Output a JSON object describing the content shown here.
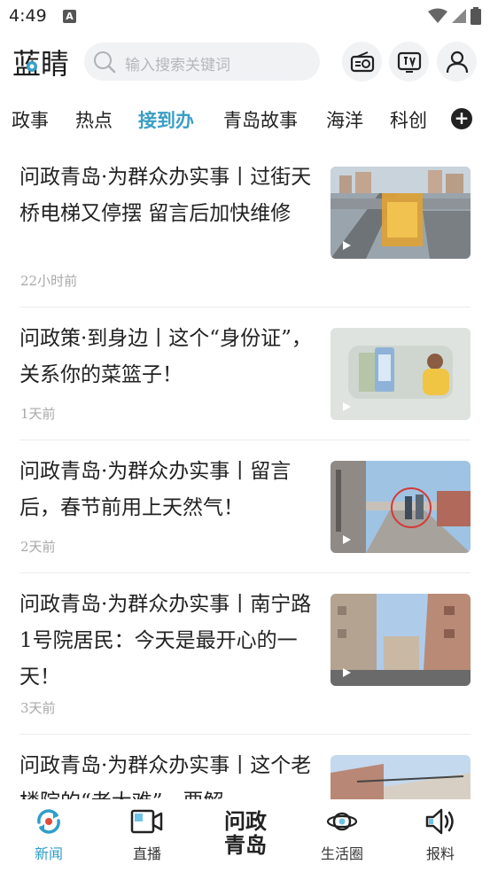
{
  "status_bar": {
    "time": "4:49",
    "notification_badge": "A"
  },
  "header": {
    "logo_text": "蓝睛",
    "search_placeholder": "输入搜索关键词",
    "icons": [
      "radio-icon",
      "tv-icon",
      "user-icon"
    ]
  },
  "tabs": [
    {
      "label": "政事",
      "active": false
    },
    {
      "label": "热点",
      "active": false
    },
    {
      "label": "接到办",
      "active": true
    },
    {
      "label": "青岛故事",
      "active": false
    },
    {
      "label": "海洋",
      "active": false
    },
    {
      "label": "科创",
      "active": false
    }
  ],
  "news": [
    {
      "title": "问政青岛·为群众办实事丨过街天桥电梯又停摆 留言后加快维修",
      "time": "22小时前",
      "has_video": true
    },
    {
      "title": "问政策·到身边丨这个“身份证”，关系你的菜篮子！",
      "time": "1天前",
      "has_video": true
    },
    {
      "title": "问政青岛·为群众办实事丨留言后，春节前用上天然气！",
      "time": "2天前",
      "has_video": true
    },
    {
      "title": "问政青岛·为群众办实事丨南宁路1号院居民：今天是最开心的一天！",
      "time": "3天前",
      "has_video": true
    },
    {
      "title": "问政青岛·为群众办实事丨这个老楼院的“老大难”，要解",
      "time": "",
      "has_video": false
    }
  ],
  "bottom_nav": {
    "items": [
      {
        "label": "新闻",
        "icon": "refresh-news-icon",
        "active": true
      },
      {
        "label": "直播",
        "icon": "video-camera-icon",
        "active": false
      },
      {
        "label": "生活圈",
        "icon": "planet-icon",
        "active": false
      },
      {
        "label": "报料",
        "icon": "speaker-icon",
        "active": false
      }
    ],
    "center": {
      "line1": "问政",
      "line2": "青岛"
    }
  },
  "colors": {
    "accent": "#3a9fc4",
    "text": "#222222",
    "meta": "#a8a8a8",
    "search_bg": "#f1f2f4"
  }
}
